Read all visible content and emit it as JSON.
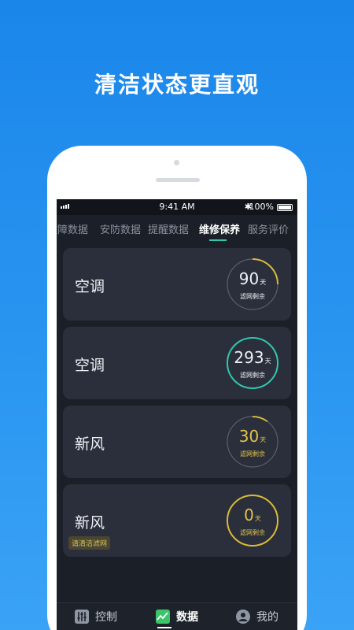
{
  "headline": "清洁状态更直观",
  "statusbar": {
    "time": "9:41 AM",
    "bluetooth": "✱",
    "battery": "100%"
  },
  "tabs": [
    {
      "label": "故障数据"
    },
    {
      "label": "安防数据"
    },
    {
      "label": "提醒数据"
    },
    {
      "label": "维修保养"
    },
    {
      "label": "服务评价"
    }
  ],
  "active_tab": "维修保养",
  "cards": [
    {
      "label": "空调",
      "value": "90",
      "unit": "天",
      "caption": "滤网剩余",
      "fraction": 0.25,
      "color": "#d8b93a",
      "text_color": "#eef0f4"
    },
    {
      "label": "空调",
      "value": "293",
      "unit": "天",
      "caption": "滤网剩余",
      "fraction": 1.0,
      "color": "#2fc7ad",
      "text_color": "#eef0f4"
    },
    {
      "label": "新风",
      "value": "30",
      "unit": "天",
      "caption": "滤网剩余",
      "fraction": 0.1,
      "color": "#d8b93a",
      "text_color": "#e2c34a"
    },
    {
      "label": "新风",
      "value": "0",
      "unit": "天",
      "caption": "滤网剩余",
      "fraction": 1.0,
      "color": "#d8b93a",
      "text_color": "#e2c34a",
      "chip": "请清洁滤网"
    }
  ],
  "tabbar": [
    {
      "label": "控制",
      "icon": "sliders-icon"
    },
    {
      "label": "数据",
      "icon": "chart-icon"
    },
    {
      "label": "我的",
      "icon": "user-icon"
    }
  ],
  "colors": {
    "accent_teal": "#2fc7ad",
    "accent_yellow": "#d8b93a",
    "card_bg": "#2a2f3b",
    "screen_bg": "#1b1f27",
    "bg_blue": "#1a86ea"
  }
}
